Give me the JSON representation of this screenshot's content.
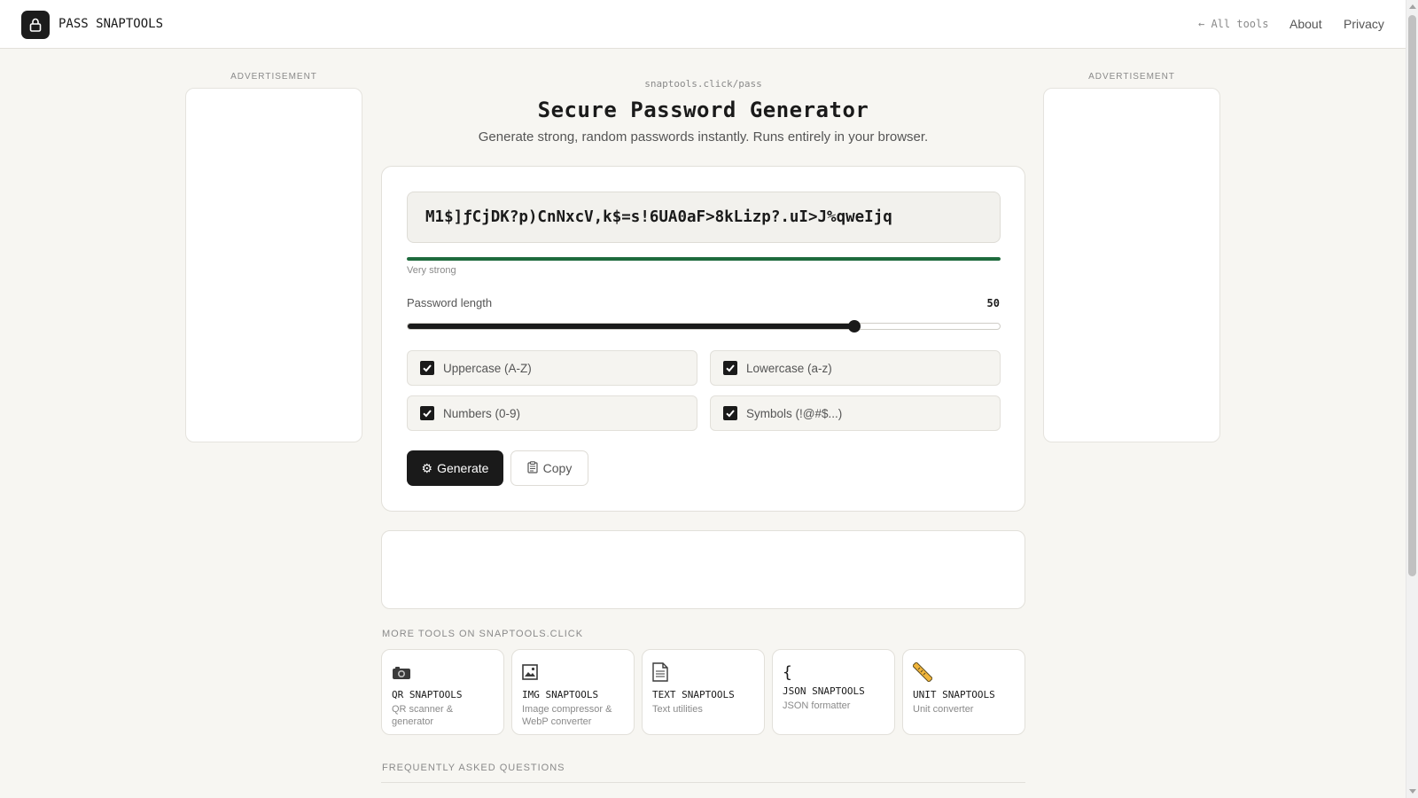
{
  "header": {
    "brand": "PASS SNAPTOOLS",
    "nav": {
      "all_tools": "← All tools",
      "about": "About",
      "privacy": "Privacy"
    }
  },
  "ads": {
    "left_label": "ADVERTISEMENT",
    "right_label": "ADVERTISEMENT"
  },
  "hero": {
    "url": "snaptools.click/pass",
    "title": "Secure Password Generator",
    "subtitle": "Generate strong, random passwords instantly. Runs entirely in your browser."
  },
  "generator": {
    "password": "M1$]ƒCjDK?p)CnNxcV,k$=s!6UA0aF>8kLizp?.uI>J%qweIjq",
    "strength_label": "Very strong",
    "strength_fraction": 1.0,
    "strength_color": "#1e6b3d",
    "length_label": "Password length",
    "length_value": "50",
    "length_slider_fraction": 0.755,
    "options": [
      {
        "label": "Uppercase (A-Z)",
        "checked": true
      },
      {
        "label": "Lowercase (a-z)",
        "checked": true
      },
      {
        "label": "Numbers (0-9)",
        "checked": true
      },
      {
        "label": "Symbols (!@#$...)",
        "checked": true
      }
    ],
    "generate_label": "Generate",
    "generate_icon": "gear-icon",
    "copy_label": "Copy",
    "copy_icon": "clipboard-icon"
  },
  "more_tools": {
    "title": "MORE TOOLS ON SNAPTOOLS.CLICK",
    "items": [
      {
        "icon": "camera-icon",
        "name": "QR SNAPTOOLS",
        "desc": "QR scanner & generator"
      },
      {
        "icon": "picture-icon",
        "name": "IMG SNAPTOOLS",
        "desc": "Image compressor & WebP converter"
      },
      {
        "icon": "document-icon",
        "name": "TEXT SNAPTOOLS",
        "desc": "Text utilities"
      },
      {
        "icon": "brace-icon",
        "name": "JSON SNAPTOOLS",
        "desc": "JSON formatter"
      },
      {
        "icon": "ruler-icon",
        "name": "UNIT SNAPTOOLS",
        "desc": "Unit converter"
      }
    ]
  },
  "faq": {
    "title": "FREQUENTLY ASKED QUESTIONS"
  },
  "colors": {
    "accent": "#1a1a1a",
    "background": "#f7f6f2",
    "strength": "#1e6b3d"
  }
}
